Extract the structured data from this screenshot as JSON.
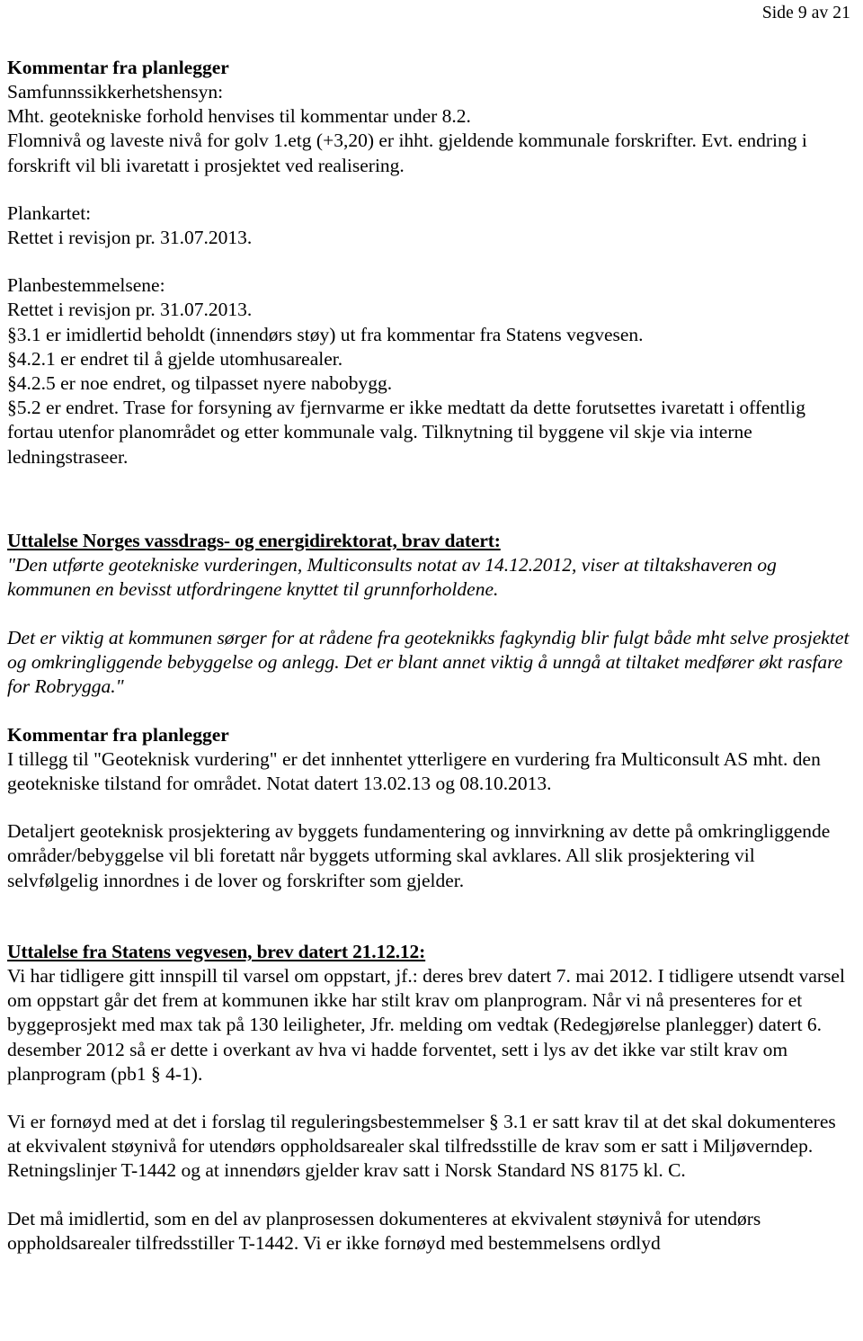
{
  "header": {
    "page_indicator": "Side 9 av 21"
  },
  "sections": {
    "kommentar_1": {
      "heading": "Kommentar fra planlegger",
      "lines": [
        "Samfunnssikkerhetshensyn:",
        "Mht. geotekniske forhold henvises til kommentar under 8.2.",
        "Flomnivå og laveste nivå for golv 1.etg (+3,20) er ihht. gjeldende kommunale forskrifter. Evt. endring i forskrift vil bli ivaretatt i prosjektet ved realisering."
      ],
      "plankartet_label": "Plankartet:",
      "plankartet_value": "Rettet i revisjon pr. 31.07.2013.",
      "planbestemmelsene_label": "Planbestemmelsene:",
      "planbestemmelsene_lines": [
        "Rettet i revisjon pr. 31.07.2013.",
        "§3.1 er imidlertid beholdt (innendørs støy) ut fra kommentar fra Statens vegvesen.",
        "§4.2.1 er endret til å gjelde utomhusarealer.",
        "§4.2.5 er noe endret, og tilpasset nyere nabobygg."
      ],
      "paragraf_52": "§5.2 er endret. Trase for forsyning av fjernvarme er ikke medtatt da dette forutsettes ivaretatt i offentlig fortau utenfor planområdet og etter kommunale valg. Tilknytning til byggene vil skje via interne ledningstraseer."
    },
    "nve": {
      "heading": "Uttalelse Norges vassdrags- og energidirektorat, brav datert:",
      "quote_para_1": "\"Den utførte geotekniske vurderingen, Multiconsults notat av 14.12.2012, viser at tiltakshaveren og kommunen en bevisst utfordringene knyttet til grunnforholdene.",
      "quote_para_2": "Det er viktig at kommunen sørger for at rådene fra geoteknikks fagkyndig blir fulgt både mht selve prosjektet og omkringliggende bebyggelse og anlegg. Det er blant annet viktig å unngå at tiltaket medfører økt rasfare for Robrygga.\""
    },
    "kommentar_2": {
      "heading": "Kommentar fra planlegger",
      "para_1": "I tillegg til \"Geoteknisk vurdering\" er det innhentet ytterligere en vurdering fra Multiconsult AS mht. den geotekniske tilstand for området. Notat datert 13.02.13 og 08.10.2013.",
      "para_2": "Detaljert geoteknisk prosjektering av byggets fundamentering og innvirkning av dette på omkringliggende områder/bebyggelse vil bli foretatt når byggets utforming skal avklares. All slik prosjektering vil selvfølgelig innordnes i de lover og forskrifter som gjelder."
    },
    "vegvesen": {
      "heading": "Uttalelse fra Statens vegvesen, brev datert 21.12.12:",
      "para_1": "Vi har tidligere gitt innspill til varsel om oppstart, jf.: deres brev datert 7. mai 2012. I tidligere utsendt varsel om oppstart går det frem at kommunen ikke har stilt krav om planprogram. Når vi nå presenteres for et byggeprosjekt med max tak på 130 leiligheter, Jfr. melding om vedtak (Redegjørelse planlegger) datert 6. desember 2012 så er dette i overkant av hva vi hadde forventet, sett i lys av det ikke var stilt krav om planprogram (pb1 § 4-1).",
      "para_2": "Vi er fornøyd med at det i forslag til reguleringsbestemmelser § 3.1 er satt krav til at det skal dokumenteres at ekvivalent støynivå for utendørs oppholdsarealer skal tilfredsstille de krav som er satt i Miljøverndep. Retningslinjer T-1442 og at innendørs gjelder krav satt i Norsk Standard NS 8175 kl. C.",
      "para_3": "Det må imidlertid, som en del av planprosessen dokumenteres at ekvivalent støynivå for utendørs oppholdsarealer tilfredsstiller T-1442. Vi er ikke fornøyd med bestemmelsens ordlyd"
    }
  }
}
